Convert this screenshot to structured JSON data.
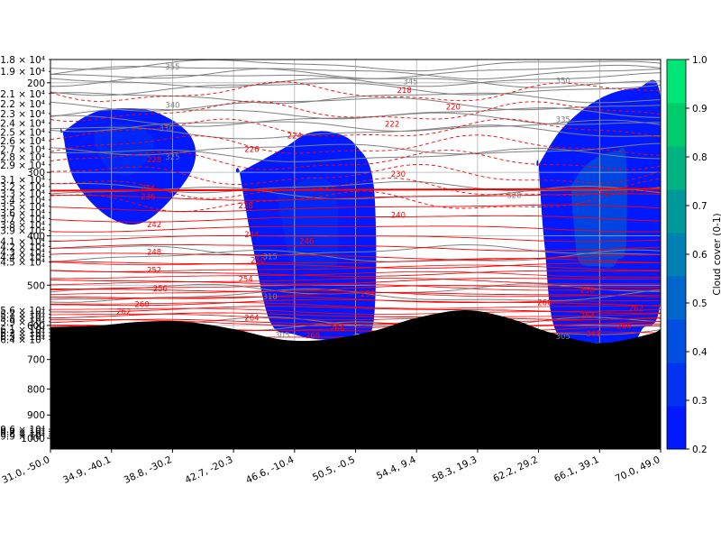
{
  "chart_data": {
    "type": "contour",
    "x_tick_labels": [
      "31.0, -50.0",
      "34.9, -40.1",
      "38.8, -30.2",
      "42.7, -20.3",
      "46.6, -10.4",
      "50.5, -0.5",
      "54.4, 9.4",
      "58.3, 19.3",
      "62.2, 29.2",
      "66.1, 39.1",
      "70.0, 49.0"
    ],
    "y_axis": {
      "scale": "log",
      "inverted": true,
      "range": [
        180,
        1050
      ],
      "major_ticks": [
        200,
        300,
        400,
        500,
        600,
        700,
        800,
        900,
        1000
      ],
      "minor_ticks": [
        {
          "v": 180,
          "label": "1.8 × 10⁴"
        },
        {
          "v": 190,
          "label": "1.9 × 10⁴"
        },
        {
          "v": 210,
          "label": "2.1 × 10⁴"
        },
        {
          "v": 220,
          "label": "2.2 × 10⁴"
        },
        {
          "v": 230,
          "label": "2.3 × 10⁴"
        },
        {
          "v": 240,
          "label": "2.4 × 10⁴"
        },
        {
          "v": 250,
          "label": "2.5 × 10⁴"
        },
        {
          "v": 260,
          "label": "2.6 × 10⁴"
        },
        {
          "v": 270,
          "label": "2.7 × 10⁴"
        },
        {
          "v": 280,
          "label": "2.8 × 10⁴"
        },
        {
          "v": 290,
          "label": "2.9 × 10⁴"
        },
        {
          "v": 310,
          "label": "3.1 × 10⁴"
        },
        {
          "v": 320,
          "label": "3.2 × 10⁴"
        },
        {
          "v": 330,
          "label": "3.3 × 10⁴"
        },
        {
          "v": 340,
          "label": "3.4 × 10⁴"
        },
        {
          "v": 350,
          "label": "3.5 × 10⁴"
        },
        {
          "v": 360,
          "label": "3.6 × 10⁴"
        },
        {
          "v": 370,
          "label": "3.7 × 10⁴"
        },
        {
          "v": 380,
          "label": "3.8 × 10⁴"
        },
        {
          "v": 390,
          "label": "3.9 × 10⁴"
        },
        {
          "v": 410,
          "label": "4.1 × 10⁴"
        },
        {
          "v": 420,
          "label": "4.2 × 10⁴"
        },
        {
          "v": 430,
          "label": "4.3 × 10⁴"
        },
        {
          "v": 440,
          "label": "4.4 × 10⁴"
        },
        {
          "v": 450,
          "label": "4.5 × 10⁴"
        },
        {
          "v": 560,
          "label": "5.6 × 10⁴"
        },
        {
          "v": 570,
          "label": "5.7 × 10⁴"
        },
        {
          "v": 580,
          "label": "5.8 × 10⁴"
        },
        {
          "v": 590,
          "label": "5.9 × 10⁴"
        },
        {
          "v": 610,
          "label": "6.1 × 10⁴"
        },
        {
          "v": 620,
          "label": "6.2 × 10⁴"
        },
        {
          "v": 630,
          "label": "6.3 × 10⁴"
        },
        {
          "v": 640,
          "label": "6.4 × 10⁴"
        },
        {
          "v": 960,
          "label": "9.6 × 10⁴"
        },
        {
          "v": 970,
          "label": "9.7 × 10⁴"
        },
        {
          "v": 980,
          "label": "9.8 × 10⁴"
        },
        {
          "v": 990,
          "label": "9.9 × 10⁴"
        }
      ]
    },
    "grid": true,
    "colorbar": {
      "label": "Cloud cover (0-1)",
      "range": [
        0.2,
        1.0
      ],
      "ticks": [
        "0.2",
        "0.3",
        "0.4",
        "0.5",
        "0.6",
        "0.7",
        "0.8",
        "0.9",
        "1.0"
      ],
      "colors": [
        "#0019ff",
        "#0033f2",
        "#004fe0",
        "#0066cc",
        "#0080b3",
        "#00999a",
        "#00b381",
        "#00cc6b",
        "#00e676"
      ]
    },
    "cloud_regions": [
      {
        "x": [
          0.2,
          0.4,
          1.0,
          1.6,
          2.3,
          2.3,
          1.7,
          1.0,
          0.6,
          0.2
        ],
        "p": [
          250,
          312,
          370,
          372,
          300,
          255,
          228,
          225,
          232,
          250
        ],
        "level": 0.22,
        "core_level": 0.36
      },
      {
        "x": [
          3.1,
          3.3,
          3.6,
          4.0,
          4.5,
          5.0,
          5.3,
          5.3,
          5.0,
          4.6,
          4.2,
          3.8,
          3.1
        ],
        "p": [
          300,
          410,
          590,
          625,
          640,
          625,
          585,
          320,
          265,
          250,
          252,
          270,
          300
        ],
        "level": 0.22,
        "core_level": 0.36
      },
      {
        "x": [
          8.0,
          8.1,
          8.3,
          9.0,
          9.5,
          9.7,
          10.0,
          10.0,
          9.6,
          9.0,
          8.4,
          8.0
        ],
        "p": [
          290,
          420,
          620,
          650,
          655,
          610,
          530,
          215,
          205,
          215,
          245,
          290
        ],
        "level": 0.22,
        "core_level": 0.5
      }
    ],
    "terrain_surface_hpa": {
      "x": [
        0,
        0.8,
        1.5,
        2.2,
        3.0,
        3.8,
        4.5,
        5.3,
        6.0,
        6.8,
        7.5,
        8.2,
        9.0,
        9.8,
        10
      ],
      "p": [
        605,
        600,
        590,
        590,
        610,
        640,
        640,
        615,
        580,
        560,
        580,
        620,
        650,
        625,
        610
      ]
    },
    "temperature_contours": {
      "color": "#ff0000",
      "values": [
        218,
        220,
        222,
        224,
        226,
        228,
        230,
        232,
        234,
        236,
        238,
        240,
        242,
        244,
        246,
        248,
        250,
        252,
        254,
        256,
        258,
        260,
        262,
        264,
        266,
        268
      ],
      "labels": [
        {
          "text": "218",
          "x": 5.8,
          "p": 207
        },
        {
          "text": "220",
          "x": 6.6,
          "p": 223
        },
        {
          "text": "222",
          "x": 5.6,
          "p": 241
        },
        {
          "text": "224",
          "x": 4.0,
          "p": 254
        },
        {
          "text": "226",
          "x": 3.3,
          "p": 270
        },
        {
          "text": "228",
          "x": 1.7,
          "p": 283
        },
        {
          "text": "230",
          "x": 5.7,
          "p": 302
        },
        {
          "text": "234",
          "x": 1.6,
          "p": 322
        },
        {
          "text": "236",
          "x": 1.6,
          "p": 335
        },
        {
          "text": "238",
          "x": 3.2,
          "p": 349
        },
        {
          "text": "240",
          "x": 5.7,
          "p": 364
        },
        {
          "text": "242",
          "x": 1.7,
          "p": 380
        },
        {
          "text": "244",
          "x": 3.3,
          "p": 397
        },
        {
          "text": "246",
          "x": 4.2,
          "p": 410
        },
        {
          "text": "248",
          "x": 1.7,
          "p": 430
        },
        {
          "text": "250",
          "x": 3.4,
          "p": 446
        },
        {
          "text": "252",
          "x": 1.7,
          "p": 467
        },
        {
          "text": "254",
          "x": 3.2,
          "p": 486
        },
        {
          "text": "256",
          "x": 1.8,
          "p": 508
        },
        {
          "text": "258",
          "x": 5.2,
          "p": 520
        },
        {
          "text": "258",
          "x": 8.8,
          "p": 511
        },
        {
          "text": "260",
          "x": 1.5,
          "p": 545
        },
        {
          "text": "260",
          "x": 8.1,
          "p": 541
        },
        {
          "text": "262",
          "x": 1.2,
          "p": 563
        },
        {
          "text": "262",
          "x": 9.6,
          "p": 555
        },
        {
          "text": "264",
          "x": 3.3,
          "p": 580
        },
        {
          "text": "264",
          "x": 8.8,
          "p": 574
        },
        {
          "text": "266",
          "x": 4.7,
          "p": 607
        },
        {
          "text": "266",
          "x": 9.4,
          "p": 602
        },
        {
          "text": "268",
          "x": 4.3,
          "p": 628
        },
        {
          "text": "268",
          "x": 8.9,
          "p": 623
        }
      ]
    },
    "theta_contours": {
      "color": "#808080",
      "values": [
        305,
        310,
        315,
        320,
        325,
        330,
        335,
        340,
        345,
        350,
        355
      ],
      "labels": [
        {
          "text": "355",
          "x": 2.0,
          "p": 186
        },
        {
          "text": "345",
          "x": 5.9,
          "p": 199
        },
        {
          "text": "350",
          "x": 8.4,
          "p": 198
        },
        {
          "text": "340",
          "x": 2.0,
          "p": 221
        },
        {
          "text": "335",
          "x": 8.4,
          "p": 236
        },
        {
          "text": "330",
          "x": 1.9,
          "p": 246
        },
        {
          "text": "325",
          "x": 2.0,
          "p": 280
        },
        {
          "text": "320",
          "x": 7.6,
          "p": 333
        },
        {
          "text": "315",
          "x": 3.6,
          "p": 439
        },
        {
          "text": "310",
          "x": 3.6,
          "p": 527
        },
        {
          "text": "305",
          "x": 3.8,
          "p": 627
        },
        {
          "text": "305",
          "x": 8.4,
          "p": 630
        }
      ]
    },
    "tropopause_hpa": 326
  }
}
